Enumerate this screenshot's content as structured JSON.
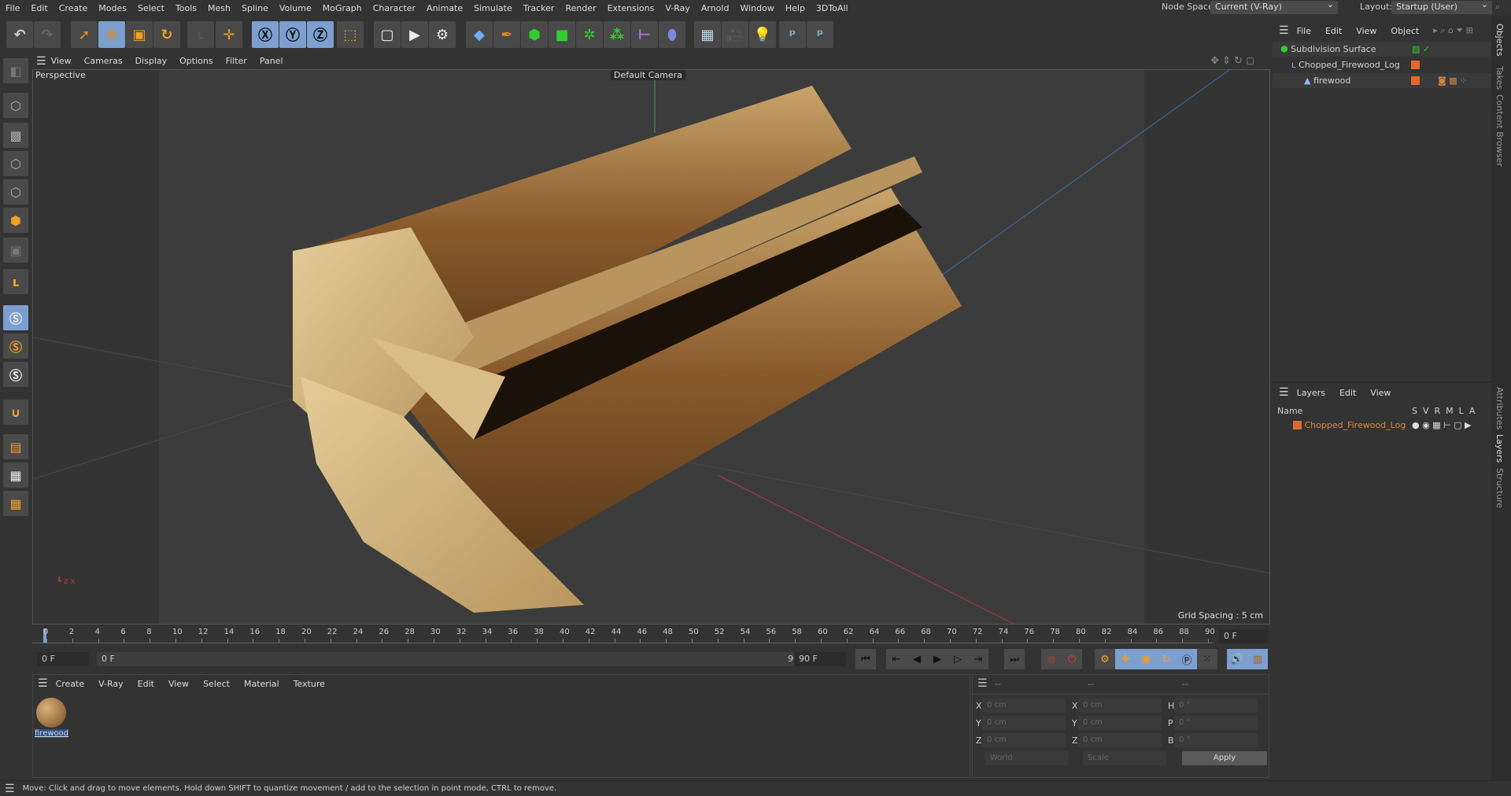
{
  "menu": [
    "File",
    "Edit",
    "Create",
    "Modes",
    "Select",
    "Tools",
    "Mesh",
    "Spline",
    "Volume",
    "MoGraph",
    "Character",
    "Animate",
    "Simulate",
    "Tracker",
    "Render",
    "Extensions",
    "V-Ray",
    "Arnold",
    "Window",
    "Help",
    "3DToAll"
  ],
  "node_space": {
    "label": "Node Space:",
    "value": "Current (V-Ray)"
  },
  "layout": {
    "label": "Layout:",
    "value": "Startup (User)"
  },
  "viewport": {
    "menu": [
      "View",
      "Cameras",
      "Display",
      "Options",
      "Filter",
      "Panel"
    ],
    "name": "Perspective",
    "camera": "Default Camera",
    "grid": "Grid Spacing : 5 cm"
  },
  "objects": {
    "menu": [
      "File",
      "Edit",
      "View",
      "Object"
    ],
    "items": [
      {
        "name": "Subdivision Surface"
      },
      {
        "name": "Chopped_Firewood_Log"
      },
      {
        "name": "firewood"
      }
    ]
  },
  "layers": {
    "menu": [
      "Layers",
      "Edit",
      "View"
    ],
    "header": "Name",
    "cols": [
      "S",
      "V",
      "R",
      "M",
      "L",
      "A"
    ],
    "items": [
      {
        "name": "Chopped_Firewood_Log",
        "color": "#e06a2a"
      }
    ]
  },
  "side_tabs": [
    "Objects",
    "Takes",
    "Content Browser",
    "Attributes",
    "Layers",
    "Structure"
  ],
  "timeline": {
    "ticks": [
      0,
      2,
      4,
      6,
      8,
      10,
      12,
      14,
      16,
      18,
      20,
      22,
      24,
      26,
      28,
      30,
      32,
      34,
      36,
      38,
      40,
      42,
      44,
      46,
      48,
      50,
      52,
      54,
      56,
      58,
      60,
      62,
      64,
      66,
      68,
      70,
      72,
      74,
      76,
      78,
      80,
      82,
      84,
      86,
      88,
      90
    ],
    "current": "0 F",
    "start": "0 F",
    "range_start": "0 F",
    "range_end": "90 F",
    "end": "90 F"
  },
  "materials": {
    "menu": [
      "Create",
      "V-Ray",
      "Edit",
      "View",
      "Select",
      "Material",
      "Texture"
    ],
    "items": [
      {
        "name": "firewood"
      }
    ]
  },
  "coords": {
    "headers": [
      "--",
      "--",
      "--"
    ],
    "rows": [
      {
        "a": "X",
        "av": "0 cm",
        "b": "X",
        "bv": "0 cm",
        "c": "H",
        "cv": "0 °"
      },
      {
        "a": "Y",
        "av": "0 cm",
        "b": "Y",
        "bv": "0 cm",
        "c": "P",
        "cv": "0 °"
      },
      {
        "a": "Z",
        "av": "0 cm",
        "b": "Z",
        "bv": "0 cm",
        "c": "B",
        "cv": "0 °"
      }
    ],
    "space": "World",
    "mode": "Scale",
    "apply": "Apply"
  },
  "status": "Move: Click and drag to move elements. Hold down SHIFT to quantize movement / add to the selection in point mode, CTRL to remove."
}
